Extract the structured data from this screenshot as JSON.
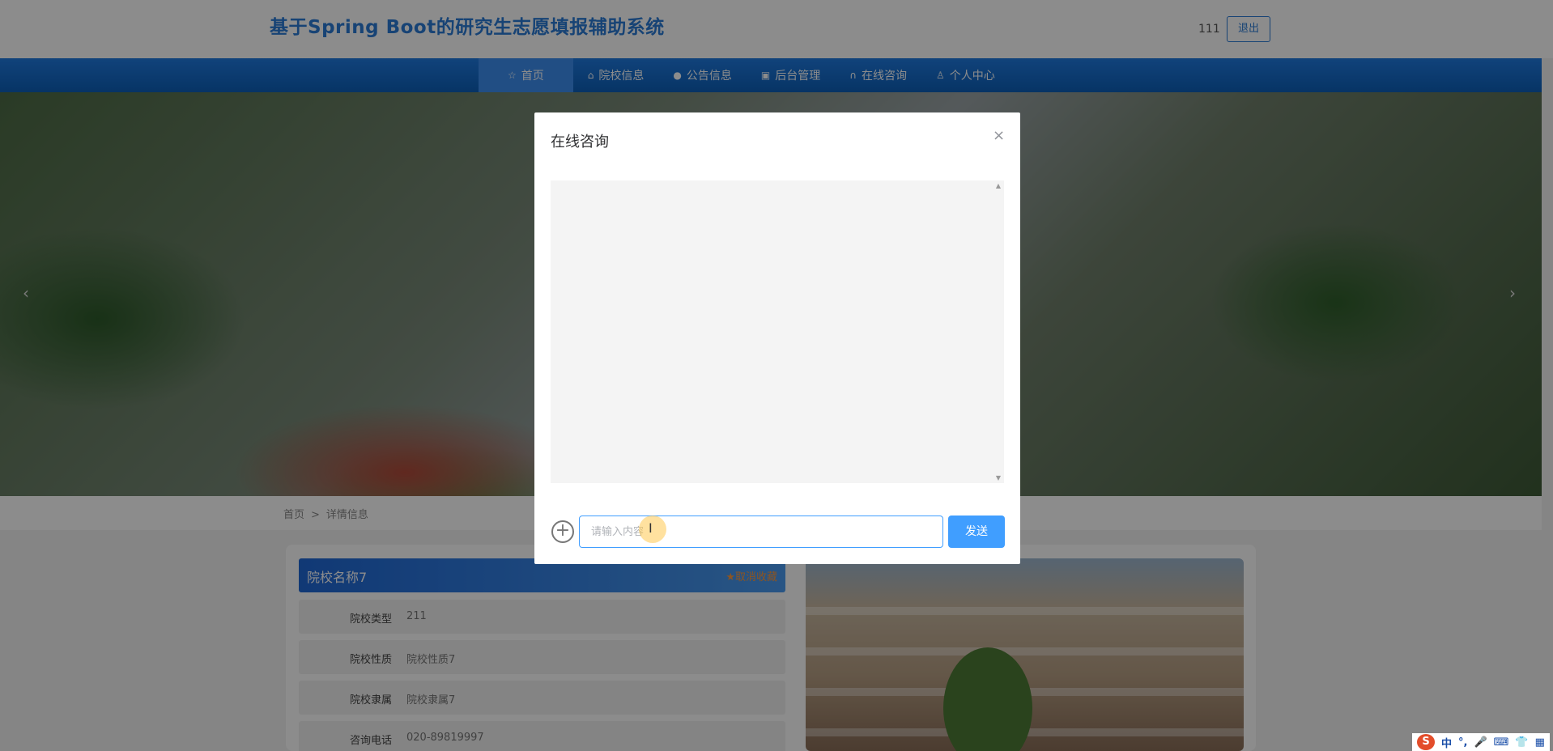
{
  "header": {
    "site_title": "基于Spring Boot的研究生志愿填报辅助系统",
    "username": "111",
    "logout_label": "退出"
  },
  "nav": {
    "items": [
      {
        "label": "首页",
        "icon": "star-icon"
      },
      {
        "label": "院校信息",
        "icon": "school-icon"
      },
      {
        "label": "公告信息",
        "icon": "info-icon"
      },
      {
        "label": "后台管理",
        "icon": "briefcase-icon"
      },
      {
        "label": "在线咨询",
        "icon": "headset-icon"
      },
      {
        "label": "个人中心",
        "icon": "user-icon"
      }
    ],
    "active_item": "首页"
  },
  "breadcrumb": {
    "home": "首页",
    "separator": ">",
    "current": "详情信息"
  },
  "detail": {
    "school_name": "院校名称7",
    "favorite_label": "★取消收藏",
    "rows": [
      {
        "label": "院校类型",
        "value": "211"
      },
      {
        "label": "院校性质",
        "value": "院校性质7"
      },
      {
        "label": "院校隶属",
        "value": "院校隶属7"
      },
      {
        "label": "咨询电话",
        "value": "020-89819997"
      }
    ]
  },
  "dialog": {
    "title": "在线咨询",
    "close_symbol": "×",
    "input_placeholder": "请输入内容",
    "send_label": "发送"
  },
  "tray": {
    "ime_logo": "S",
    "items": [
      "中",
      "°,",
      "🎤",
      "⌨",
      "👕",
      "▦"
    ]
  }
}
